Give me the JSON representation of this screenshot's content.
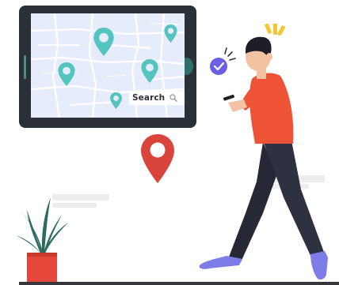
{
  "map": {
    "search_label": "Search",
    "search_icon": "magnifier-icon"
  },
  "colors": {
    "tablet_frame": "#2b2f38",
    "map_background": "#e7ecfb",
    "map_pin": "#53c4bf",
    "location_pin": "#d9453b",
    "shirt": "#ef5337",
    "pants": "#2e3140",
    "shoes": "#7e7de8",
    "hair": "#1e1e28",
    "skin": "#f2c2a3",
    "check_badge": "#6a5fe6",
    "alert_marks": "#f2c62f",
    "plant_pot": "#e5473a",
    "plant_leaves": "#2d6b60"
  },
  "icons": [
    "map-pin-icon",
    "location-pin-icon",
    "check-badge-icon",
    "magnifier-icon",
    "alert-marks-icon"
  ]
}
